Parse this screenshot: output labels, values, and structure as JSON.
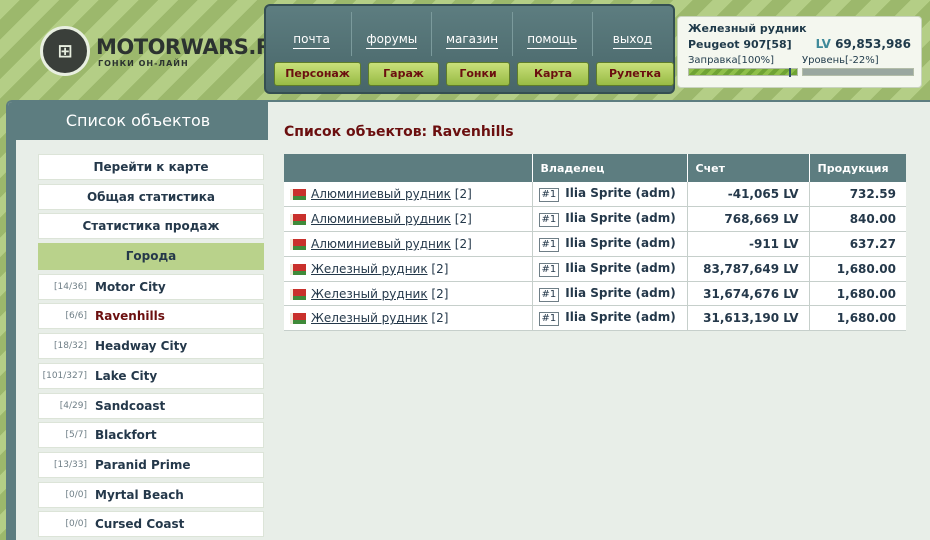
{
  "logo": {
    "title": "MOTORWARS.RU",
    "subtitle": "ГОНКИ ОН-ЛАЙН"
  },
  "nav": {
    "top": [
      "почта",
      "форумы",
      "магазин",
      "помощь",
      "выход"
    ],
    "bottom": [
      "Персонаж",
      "Гараж",
      "Гонки",
      "Карта",
      "Рулетка"
    ]
  },
  "status": {
    "location": "Железный рудник",
    "car": "Peugeot 907[58]",
    "currency": "LV",
    "money": "69,853,986",
    "fuel_label": "Заправка[100%]",
    "level_label": "Уровень[-22%]",
    "fuel_percent": 100
  },
  "sidebar": {
    "title": "Список объектов",
    "buttons": [
      "Перейти к карте",
      "Общая статистика",
      "Статистика продаж"
    ],
    "section": "Города",
    "cities": [
      {
        "count": "[14/36]",
        "name": "Motor City"
      },
      {
        "count": "[6/6]",
        "name": "Ravenhills",
        "active": true
      },
      {
        "count": "[18/32]",
        "name": "Headway City"
      },
      {
        "count": "[101/327]",
        "name": "Lake City"
      },
      {
        "count": "[4/29]",
        "name": "Sandcoast"
      },
      {
        "count": "[5/7]",
        "name": "Blackfort"
      },
      {
        "count": "[13/33]",
        "name": "Paranid Prime"
      },
      {
        "count": "[0/0]",
        "name": "Myrtal Beach"
      },
      {
        "count": "[0/0]",
        "name": "Cursed Coast"
      }
    ]
  },
  "content": {
    "title": "Список объектов: Ravenhills",
    "columns": [
      "",
      "Владелец",
      "Счет",
      "Продукция"
    ],
    "rows": [
      {
        "object": "Алюминиевый рудник",
        "level": "[2]",
        "owner_id": "#1",
        "owner": "Ilia Sprite (adm)",
        "account": "-41,065 LV",
        "production": "732.59"
      },
      {
        "object": "Алюминиевый рудник",
        "level": "[2]",
        "owner_id": "#1",
        "owner": "Ilia Sprite (adm)",
        "account": "768,669 LV",
        "production": "840.00"
      },
      {
        "object": "Алюминиевый рудник",
        "level": "[2]",
        "owner_id": "#1",
        "owner": "Ilia Sprite (adm)",
        "account": "-911 LV",
        "production": "637.27"
      },
      {
        "object": "Железный рудник",
        "level": "[2]",
        "owner_id": "#1",
        "owner": "Ilia Sprite (adm)",
        "account": "83,787,649 LV",
        "production": "1,680.00"
      },
      {
        "object": "Железный рудник",
        "level": "[2]",
        "owner_id": "#1",
        "owner": "Ilia Sprite (adm)",
        "account": "31,674,676 LV",
        "production": "1,680.00"
      },
      {
        "object": "Железный рудник",
        "level": "[2]",
        "owner_id": "#1",
        "owner": "Ilia Sprite (adm)",
        "account": "31,613,190 LV",
        "production": "1,680.00"
      }
    ]
  }
}
